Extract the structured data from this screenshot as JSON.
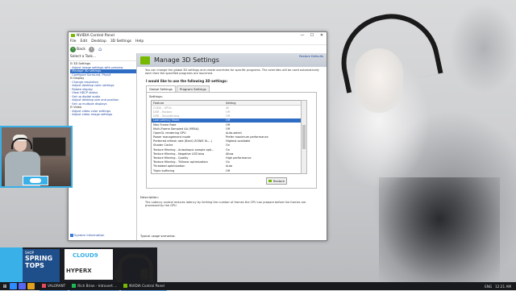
{
  "window": {
    "title": "NVIDIA Control Panel",
    "controls": [
      "—",
      "☐",
      "✕"
    ]
  },
  "menu": [
    "File",
    "Edit",
    "Desktop",
    "3D Settings",
    "Help"
  ],
  "toolbar": {
    "back": "Back",
    "forward": "›",
    "home_icon": "home-icon"
  },
  "sidebar": {
    "label": "Select a Task...",
    "tree": [
      {
        "text": "⊟ 3D Settings",
        "type": "cat"
      },
      {
        "text": "   · Adjust image settings with preview",
        "type": "link"
      },
      {
        "text": "   · Manage 3D settings",
        "type": "sel"
      },
      {
        "text": "   · Configure Surround, PhysX",
        "type": "link"
      },
      {
        "text": "⊟ Display",
        "type": "cat"
      },
      {
        "text": "   · Change resolution",
        "type": "link"
      },
      {
        "text": "   · Adjust desktop color settings",
        "type": "link"
      },
      {
        "text": "   · Rotate display",
        "type": "link"
      },
      {
        "text": "   · View HDCP status",
        "type": "link"
      },
      {
        "text": "   · Set up digital audio",
        "type": "link"
      },
      {
        "text": "   · Adjust desktop size and position",
        "type": "link"
      },
      {
        "text": "   · Set up multiple displays",
        "type": "link"
      },
      {
        "text": "⊟ Video",
        "type": "cat"
      },
      {
        "text": "   · Adjust video color settings",
        "type": "link"
      },
      {
        "text": "   · Adjust video image settings",
        "type": "link"
      }
    ],
    "system_info": "System Information"
  },
  "main": {
    "title": "Manage 3D Settings",
    "restore_defaults": "Restore Defaults",
    "description": "You can change the global 3D settings and create overrides for specific programs. The overrides will be used automatically each time the specified programs are launched.",
    "subheading": "I would like to use the following 3D settings:",
    "tabs": [
      "Global Settings",
      "Program Settings"
    ],
    "settings_label": "Settings:",
    "grid_header": {
      "feature": "Feature",
      "setting": "Setting"
    },
    "rows": [
      {
        "feature": "CUDA - GPUs",
        "setting": "All",
        "state": "dim"
      },
      {
        "feature": "DSR - Factors",
        "setting": "Off",
        "state": "dim"
      },
      {
        "feature": "DSR - Smoothness",
        "setting": "Off",
        "state": "dim"
      },
      {
        "feature": "Low Latency Mode",
        "setting": "Off",
        "state": "sel"
      },
      {
        "feature": "Max Frame Rate",
        "setting": "Off",
        "state": ""
      },
      {
        "feature": "Multi-Frame Sampled AA (MFAA)",
        "setting": "Off",
        "state": ""
      },
      {
        "feature": "OpenGL rendering GPU",
        "setting": "Auto-select",
        "state": ""
      },
      {
        "feature": "Power management mode",
        "setting": "Prefer maximum performance",
        "state": ""
      },
      {
        "feature": "Preferred refresh rate (BenQ ZOWIE XL...)",
        "setting": "Highest available",
        "state": ""
      },
      {
        "feature": "Shader Cache",
        "setting": "On",
        "state": ""
      },
      {
        "feature": "Texture filtering - Anisotropic sample opti...",
        "setting": "On",
        "state": ""
      },
      {
        "feature": "Texture filtering - Negative LOD bias",
        "setting": "Allow",
        "state": ""
      },
      {
        "feature": "Texture filtering - Quality",
        "setting": "High performance",
        "state": ""
      },
      {
        "feature": "Texture filtering - Trilinear optimization",
        "setting": "On",
        "state": ""
      },
      {
        "feature": "Threaded optimization",
        "setting": "Auto",
        "state": ""
      },
      {
        "feature": "Triple buffering",
        "setting": "Off",
        "state": ""
      },
      {
        "feature": "Vertical sync",
        "setting": "Off",
        "state": ""
      }
    ],
    "restore_button": "Restore",
    "description_label": "Description:",
    "description_text": "The Latency control reduces latency by limiting the number of frames the CPU can prepare before the frames are processed by the GPU.",
    "usage_label": "Typical usage scenarios:"
  },
  "promo": {
    "shop": "SHOP",
    "headline": [
      "SPRING",
      "TOPS"
    ],
    "brand1": "CLOUD9",
    "brand2": "HYPERX"
  },
  "taskbar": {
    "items": [
      {
        "label": "VALORANT",
        "color": "#e84a5f"
      },
      {
        "label": "Rich Brian - Introvert ...",
        "color": "#1db954"
      },
      {
        "label": "NVIDIA Control Panel",
        "color": "#76b900"
      }
    ],
    "lang": "ENG",
    "time": "12:21 AM"
  }
}
